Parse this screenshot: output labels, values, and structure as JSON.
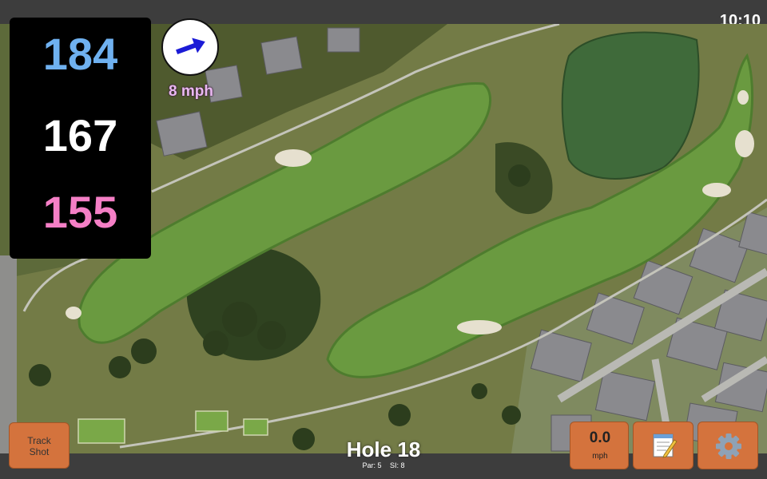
{
  "status": {
    "time": "10:10"
  },
  "distances": {
    "back": "184",
    "middle": "167",
    "front": "155"
  },
  "wind": {
    "speed_label": "8 mph"
  },
  "hole": {
    "title": "Hole 18",
    "par": "Par: 5",
    "stroke_index": "SI: 8"
  },
  "buttons": {
    "track_shot": [
      "Track",
      "Shot"
    ],
    "shot_speed_value": "0.0",
    "shot_speed_unit": "mph",
    "notes_icon": "notepad-icon",
    "settings_icon": "gear-icon"
  },
  "colors": {
    "back_distance": "#6fb1f0",
    "middle_distance": "#ffffff",
    "front_distance": "#f57fc6",
    "button": "#d4733d",
    "wind_arrow": "#1b1bd6",
    "wind_text": "#e9b8f0"
  }
}
